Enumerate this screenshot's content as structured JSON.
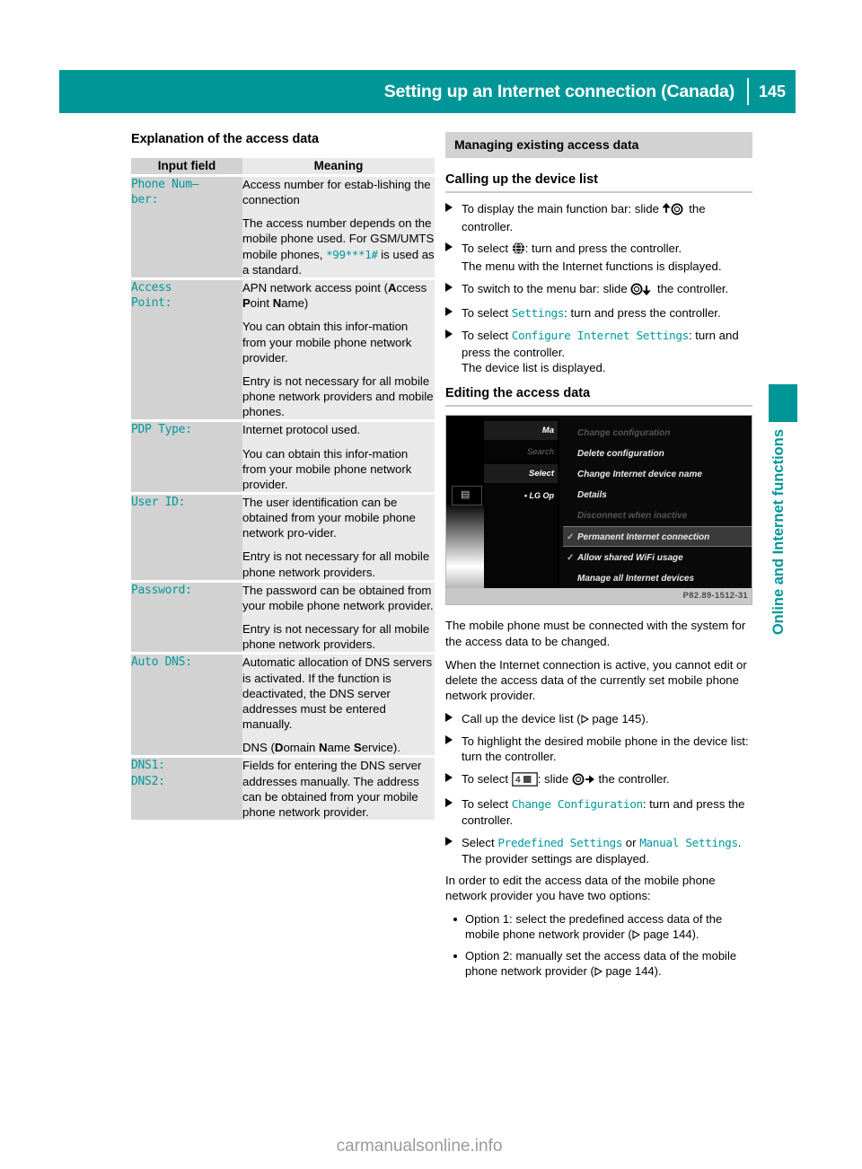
{
  "header": {
    "title": "Setting up an Internet connection (Canada)",
    "page_number": "145"
  },
  "left": {
    "section_title": "Explanation of the access data",
    "table": {
      "columns": [
        "Input field",
        "Meaning"
      ],
      "rows": [
        {
          "key": "Phone Num-\nber:",
          "key_lines": [
            "Phone Num–",
            "ber:"
          ],
          "paragraphs": [
            {
              "text": "Access number for estab-lishing the connection"
            },
            {
              "text": "The access number depends on the mobile phone used. For GSM/UMTS mobile phones, *99***1# is used as a standard.",
              "has_mono": true,
              "mono": "*99***1#"
            }
          ]
        },
        {
          "key_lines": [
            "Access",
            "Point:"
          ],
          "paragraphs": [
            {
              "text": "APN network access point (Access Point Name)",
              "bold_caps": [
                "A",
                "P",
                "N"
              ]
            },
            {
              "text": "You can obtain this infor-mation from your mobile phone network provider."
            },
            {
              "text": "Entry is not necessary for all mobile phone network providers and mobile phones."
            }
          ]
        },
        {
          "key_lines": [
            "PDP Type:"
          ],
          "paragraphs": [
            {
              "text": "Internet protocol used."
            },
            {
              "text": "You can obtain this infor-mation from your mobile phone network provider."
            }
          ]
        },
        {
          "key_lines": [
            "User ID:"
          ],
          "paragraphs": [
            {
              "text": "The user identification can be obtained from your mobile phone network pro-vider."
            },
            {
              "text": "Entry is not necessary for all mobile phone network providers."
            }
          ]
        },
        {
          "key_lines": [
            "Password:"
          ],
          "paragraphs": [
            {
              "text": "The password can be obtained from your mobile phone network provider."
            },
            {
              "text": "Entry is not necessary for all mobile phone network providers."
            }
          ]
        },
        {
          "key_lines": [
            "Auto DNS:"
          ],
          "paragraphs": [
            {
              "text": "Automatic allocation of DNS servers is activated. If the function is deactivated, the DNS server addresses must be entered manually."
            },
            {
              "text": "DNS (Domain Name Service)."
            }
          ]
        },
        {
          "key_lines": [
            "DNS1:",
            "DNS2:"
          ],
          "paragraphs": [
            {
              "text": "Fields for entering the DNS server addresses manually. The address can be obtained from your mobile phone network provider."
            }
          ]
        }
      ]
    }
  },
  "right": {
    "banner": "Managing existing access data",
    "subhead_1": "Calling up the device list",
    "steps_1": [
      {
        "pre": "To display the main function bar: slide ",
        "icon": "controller-up-icon",
        "post": " the controller."
      },
      {
        "pre": "To select ",
        "icon": "globe-icon",
        "post": ": turn and press the controller.",
        "extra": "The menu with the Internet functions is displayed."
      },
      {
        "pre": "To switch to the menu bar: slide ",
        "icon": "controller-down-icon",
        "post": " the controller."
      },
      {
        "pre": "To select ",
        "mono": "Settings",
        "post": ": turn and press the controller."
      },
      {
        "pre": "To select ",
        "mono": "Configure Internet Settings",
        "post": ": turn and press the controller.",
        "extra": "The device list is displayed."
      }
    ],
    "subhead_2": "Editing the access data",
    "screenshot": {
      "rows": [
        "Ma",
        "Search",
        "Select"
      ],
      "device": "LG Op",
      "menu_items": [
        {
          "label": "Change configuration",
          "state": "dim",
          "check": ""
        },
        {
          "label": "Delete configuration",
          "state": "normal",
          "check": ""
        },
        {
          "label": "Change Internet device name",
          "state": "normal",
          "check": ""
        },
        {
          "label": "Details",
          "state": "normal",
          "check": ""
        },
        {
          "label": "Disconnect when inactive",
          "state": "dim",
          "check": ""
        },
        {
          "label": "Permanent Internet connection",
          "state": "highlight",
          "check": "✓"
        },
        {
          "label": "Allow shared WiFi usage",
          "state": "normal",
          "check": "✓"
        },
        {
          "label": "Manage all Internet devices",
          "state": "normal",
          "check": ""
        }
      ],
      "caption": "P82.89-1512-31"
    },
    "para_1": "The mobile phone must be connected with the system for the access data to be changed.",
    "para_2": "When the Internet connection is active, you cannot edit or delete the access data of the currently set mobile phone network provider.",
    "steps_2": [
      {
        "pre": "Call up the device list (",
        "pageref": "page 145",
        "post": ")."
      },
      {
        "pre": "To highlight the desired mobile phone in the device list: turn the controller."
      },
      {
        "pre": "To select ",
        "icon": "device-list-icon",
        "post": ": slide ",
        "icon2": "controller-right-icon",
        "post2": " the controller."
      },
      {
        "pre": "To select ",
        "mono": "Change Configuration",
        "post": ": turn and press the controller."
      },
      {
        "pre": "Select ",
        "mono": "Predefined Settings",
        "mid": " or ",
        "mono2": "Manual Settings",
        "post": ".",
        "extra": "The provider settings are displayed."
      }
    ],
    "para_3": "In order to edit the access data of the mobile phone network provider you have two options:",
    "options": [
      {
        "text": "Option 1: select the predefined access data of the mobile phone network provider (",
        "pageref": "page 144",
        "post": ")."
      },
      {
        "text": "Option 2: manually set the access data of the mobile phone network provider (",
        "pageref": "page 144",
        "post": ")."
      }
    ]
  },
  "side_tab": {
    "label": "Online and Internet functions"
  },
  "watermark": "carmanualsonline.info",
  "colors": {
    "accent_teal": "#009698",
    "mono_teal": "#00999b",
    "table_key_bg": "#d2d2d2",
    "table_val_bg": "#e9e9e9"
  }
}
